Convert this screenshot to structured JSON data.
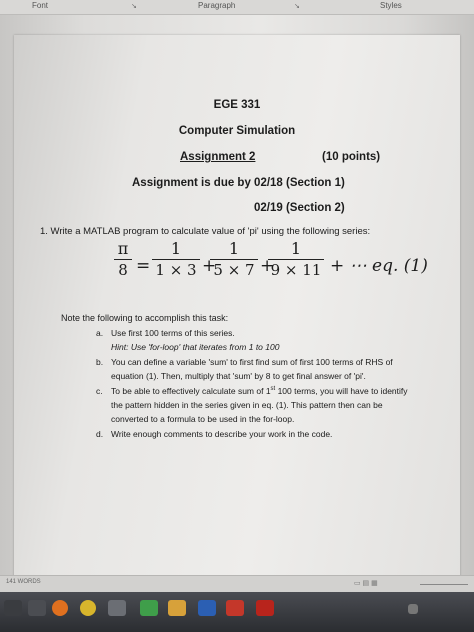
{
  "ribbon": {
    "groups": [
      "Font",
      "Paragraph",
      "Styles"
    ]
  },
  "document": {
    "course": "EGE 331",
    "subject": "Computer Simulation",
    "assignment": "Assignment 2",
    "points": "(10 points)",
    "due_line": "Assignment is due by 02/18 (Section 1)",
    "due_line2": "02/19 (Section 2)",
    "q1": "1.  Write a MATLAB program to calculate value of 'pi' using the following series:",
    "equation": {
      "lhs_num": "π",
      "lhs_den": "8",
      "equals": "=",
      "terms": [
        {
          "num": "1",
          "den": "1 × 3"
        },
        {
          "num": "1",
          "den": "5 × 7"
        },
        {
          "num": "1",
          "den": "9 × 11"
        }
      ],
      "plus": "+",
      "tail": "+ ⋯ eq. (1)"
    },
    "note": "Note the following to accomplish this task:",
    "items": [
      {
        "marker": "a.",
        "lines": [
          "Use first 100 terms of this series.",
          "Hint: Use 'for-loop' that iterates from 1 to 100"
        ]
      },
      {
        "marker": "b.",
        "lines": [
          "You can define a variable 'sum' to first find sum of first 100 terms of RHS of",
          "equation (1). Then, multiply that 'sum' by 8 to get final answer of 'pi'."
        ]
      },
      {
        "marker": "c.",
        "lines": [
          "To be able to effectively calculate sum of 1",
          "st",
          " 100 terms, you will have to identify",
          "the pattern hidden in the series given in eq. (1). This pattern then can be",
          "converted to a formula to be used in the for-loop."
        ]
      },
      {
        "marker": "d.",
        "lines": [
          "Write enough comments to describe your work in the code."
        ]
      }
    ]
  },
  "status": {
    "words": "141 WORDS"
  },
  "colors": {
    "taskbar": "#2b2d31",
    "page": "#eeedeb",
    "text": "#1c1c1c"
  }
}
